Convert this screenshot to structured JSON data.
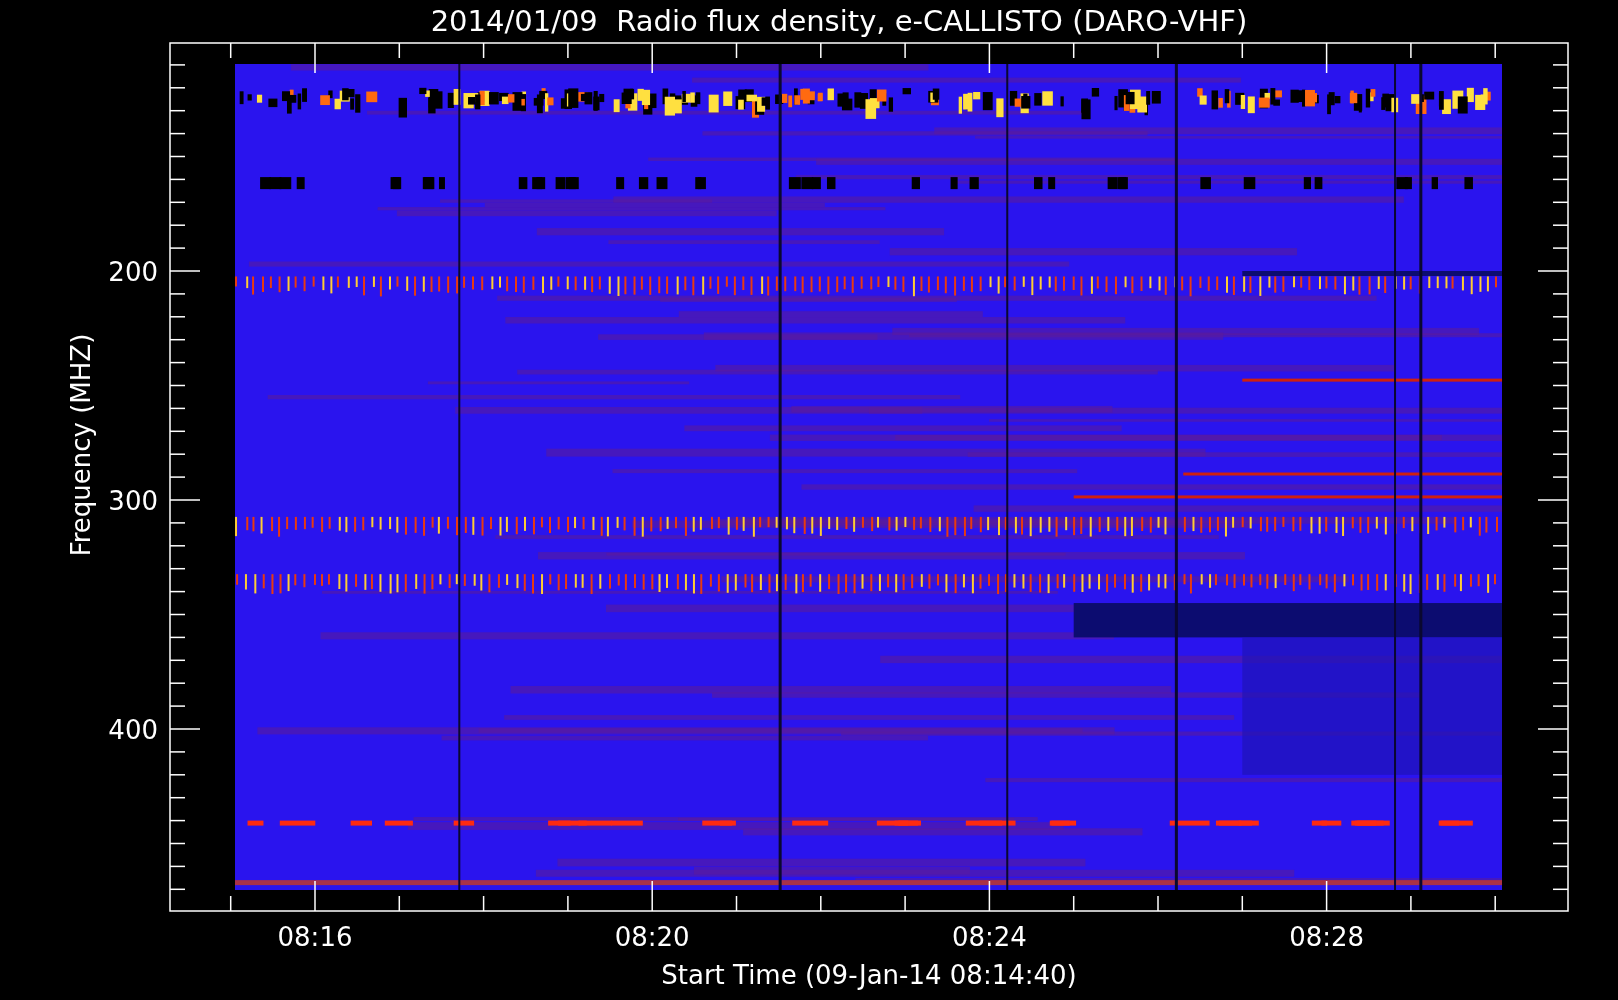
{
  "title": "2014/01/09  Radio flux density, e-CALLISTO (DARO-VHF)",
  "y_axis": {
    "label": "Frequency (MHZ)",
    "ticks": [
      "200",
      "300",
      "400"
    ]
  },
  "x_axis": {
    "label": "Start Time (09-Jan-14 08:14:40)",
    "ticks": [
      "08:16",
      "08:20",
      "08:24",
      "08:28"
    ]
  }
}
